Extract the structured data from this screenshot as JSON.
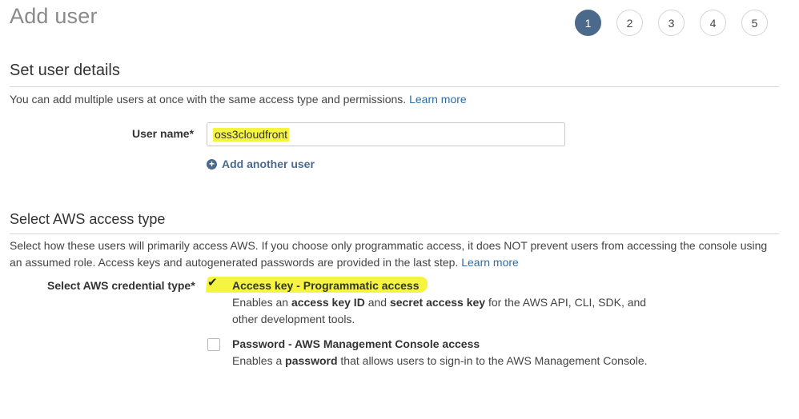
{
  "page": {
    "title": "Add user"
  },
  "steps": [
    "1",
    "2",
    "3",
    "4",
    "5"
  ],
  "active_step": 1,
  "section1": {
    "heading": "Set user details",
    "description": "You can add multiple users at once with the same access type and permissions.",
    "learn_more": "Learn more",
    "username_label": "User name*",
    "username_value": "oss3cloudfront",
    "add_another_user": "Add another user"
  },
  "section2": {
    "heading": "Select AWS access type",
    "description": "Select how these users will primarily access AWS. If you choose only programmatic access, it does NOT prevent users from accessing the console using an assumed role. Access keys and autogenerated passwords are provided in the last step.",
    "learn_more": "Learn more",
    "credential_label": "Select AWS credential type*",
    "options": [
      {
        "title": "Access key - Programmatic access",
        "checked": true,
        "desc_parts": [
          "Enables an ",
          "access key ID",
          " and ",
          "secret access key",
          " for the AWS API, CLI, SDK, and other development tools."
        ]
      },
      {
        "title": "Password - AWS Management Console access",
        "checked": false,
        "desc_parts": [
          "Enables a ",
          "password",
          " that allows users to sign-in to the AWS Management Console."
        ]
      }
    ]
  },
  "colors": {
    "accent": "#4b6a8b",
    "link": "#2e6ca4",
    "highlight": "#f5f541"
  },
  "icons": {
    "add_user": "plus-circle-icon",
    "checked": "checkmark-icon"
  }
}
